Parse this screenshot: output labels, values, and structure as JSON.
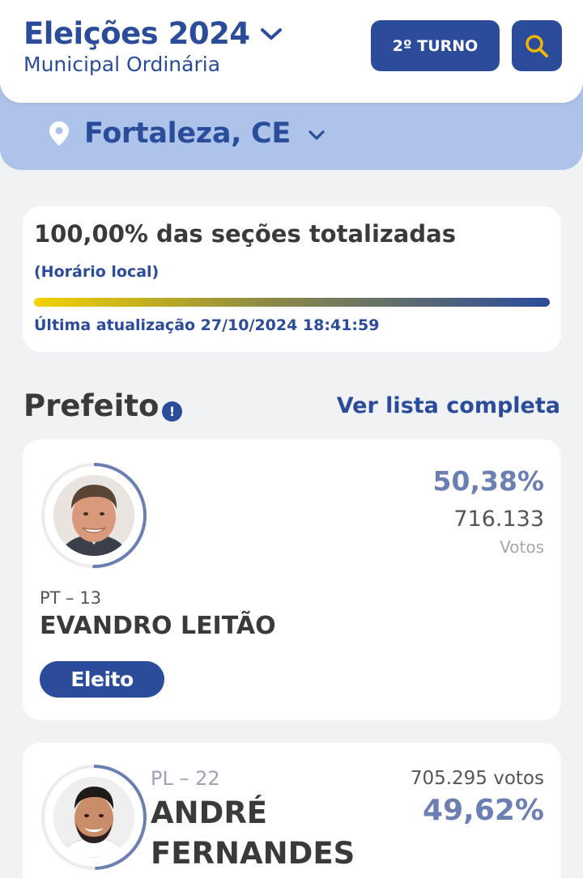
{
  "header": {
    "title": "Eleições 2024",
    "subtitle": "Municipal Ordinária",
    "turno_label": "2º TURNO",
    "search_icon": "search-icon"
  },
  "location": {
    "name": "Fortaleza, CE",
    "icon": "map-pin-icon"
  },
  "progress": {
    "title": "100,00% das seções totalizadas",
    "note": "(Horário local)",
    "percent": 100,
    "updated": "Última atualização 27/10/2024 18:41:59"
  },
  "section": {
    "title": "Prefeito",
    "see_all": "Ver lista completa"
  },
  "candidates": [
    {
      "party": "PT – 13",
      "name": "EVANDRO LEITÃO",
      "percent": "50,38%",
      "percent_value": 50.38,
      "votes": "716.133",
      "votes_label": "Votos",
      "status": "Eleito"
    },
    {
      "party": "PL – 22",
      "name": "ANDRÉ FERNANDES",
      "percent": "49,62%",
      "percent_value": 49.62,
      "votes": "705.295 votos"
    }
  ],
  "colors": {
    "primary": "#2b4c9b",
    "accent": "#f2b600",
    "ring": "#6b7fb3",
    "location_bar": "#aec3e9"
  }
}
